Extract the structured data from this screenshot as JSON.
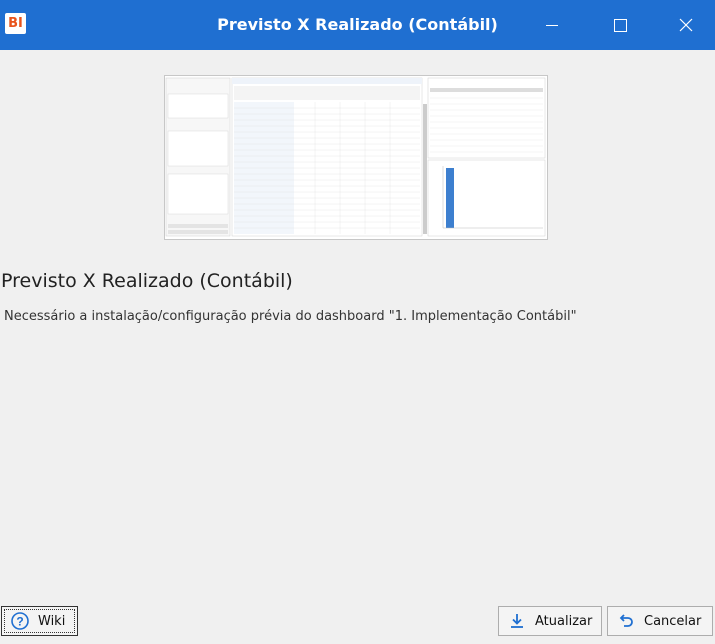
{
  "window": {
    "title": "Previsto X Realizado (Contábil)",
    "app_icon_text": "BI",
    "accent_color": "#1f6fd1"
  },
  "content": {
    "heading": "Previsto X Realizado (Contábil)",
    "description": "Necessário a instalação/configuração prévia do dashboard \"1. Implementação Contábil\""
  },
  "buttons": {
    "wiki": "Wiki",
    "update": "Atualizar",
    "cancel": "Cancelar"
  },
  "icons": {
    "app": "bi-logo-icon",
    "help": "help-circle-icon",
    "download": "download-icon",
    "undo": "undo-icon"
  }
}
